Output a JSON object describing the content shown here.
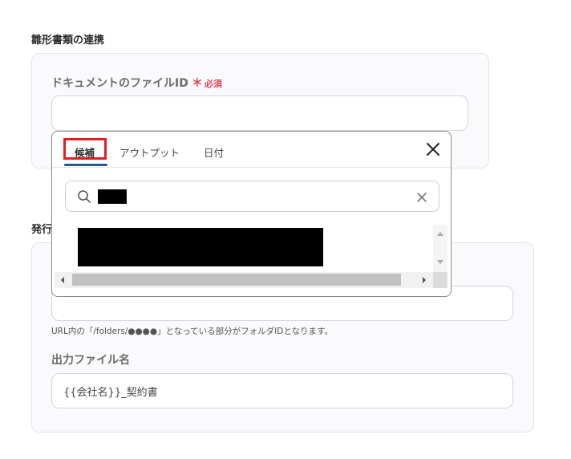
{
  "section1": {
    "title": "雛形書類の連携",
    "doc_field": {
      "label": "ドキュメントのファイルID",
      "required_star": "＊",
      "required_text": "必須",
      "value": ""
    }
  },
  "section2": {
    "title": "発行",
    "folder_field": {
      "value": "",
      "hint": "URL内の「/folders/●●●●」となっている部分がフォルダIDとなります。"
    },
    "filename_field": {
      "label": "出力ファイル名",
      "value": "{{会社名}}_契約書"
    }
  },
  "popup": {
    "tabs": [
      "候補",
      "アウトプット",
      "日付"
    ],
    "active_tab": "候補",
    "search": {
      "value": ""
    }
  },
  "icons": {
    "close": "close-icon",
    "search": "search-icon",
    "clear": "clear-icon"
  },
  "colors": {
    "required": "#e0455a",
    "tab_underline": "#245a8f",
    "highlight": "#e01f24"
  }
}
